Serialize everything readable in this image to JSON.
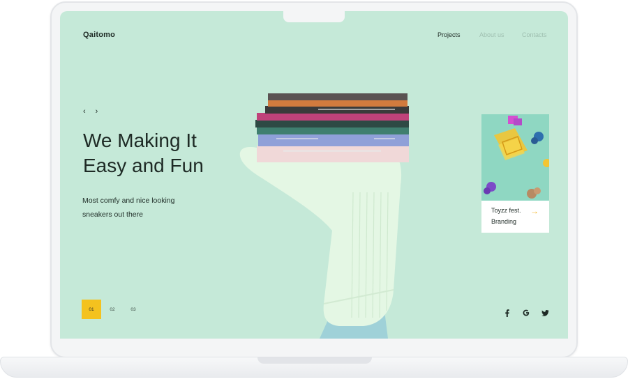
{
  "brand": {
    "logo": "Qaitomo"
  },
  "nav": {
    "items": [
      "Projects",
      "About us",
      "Contacts"
    ],
    "active": "Projects"
  },
  "hero": {
    "prev_arrow": "‹",
    "next_arrow": "›",
    "title_line1": "We Making It",
    "title_line2": "Easy and Fun",
    "subtitle_line1": "Most comfy and nice looking",
    "subtitle_line2": "sneakers out there"
  },
  "pager": {
    "pages": [
      "01",
      "02",
      "03"
    ],
    "active": "01"
  },
  "card": {
    "title": "Toyzz fest.",
    "subtitle": "Branding",
    "arrow": "→"
  },
  "social": {
    "icons": [
      "facebook-icon",
      "google-icon",
      "twitter-icon"
    ]
  },
  "colors": {
    "screen_bg": "#c5e9d8",
    "accent": "#f4c21f",
    "card_arrow": "#f2b21a",
    "text": "#1e2a25"
  }
}
